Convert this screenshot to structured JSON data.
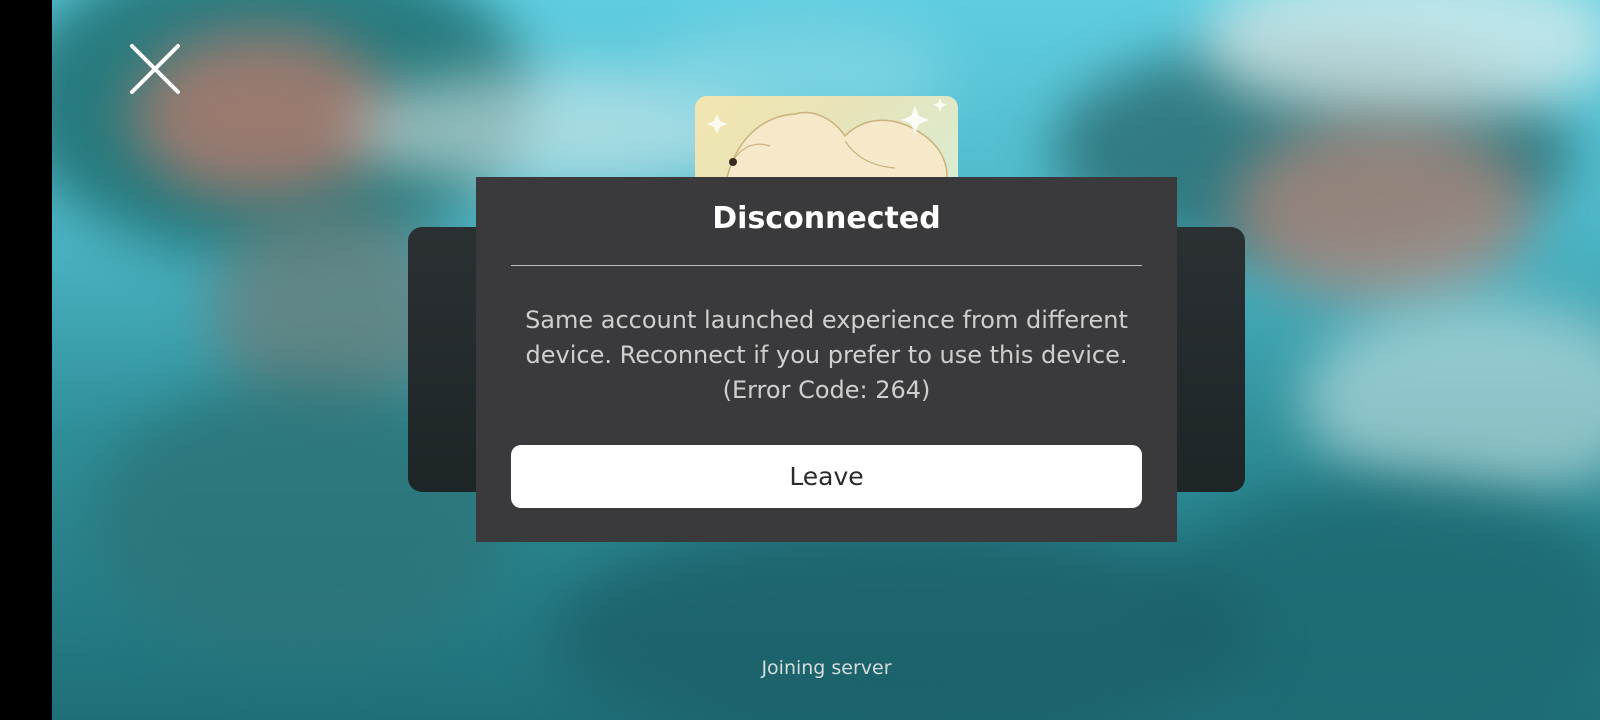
{
  "dialog": {
    "title": "Disconnected",
    "message": "Same account launched experience from different device. Reconnect if you prefer to use this device. (Error Code: 264)",
    "leave_label": "Leave"
  },
  "status": {
    "text": "Joining server"
  },
  "icons": {
    "close": "close-icon"
  },
  "colors": {
    "dialog_background": "#3a3a3c",
    "button_background": "#ffffff",
    "title_text": "#ffffff",
    "message_text": "#cfcfcf"
  }
}
